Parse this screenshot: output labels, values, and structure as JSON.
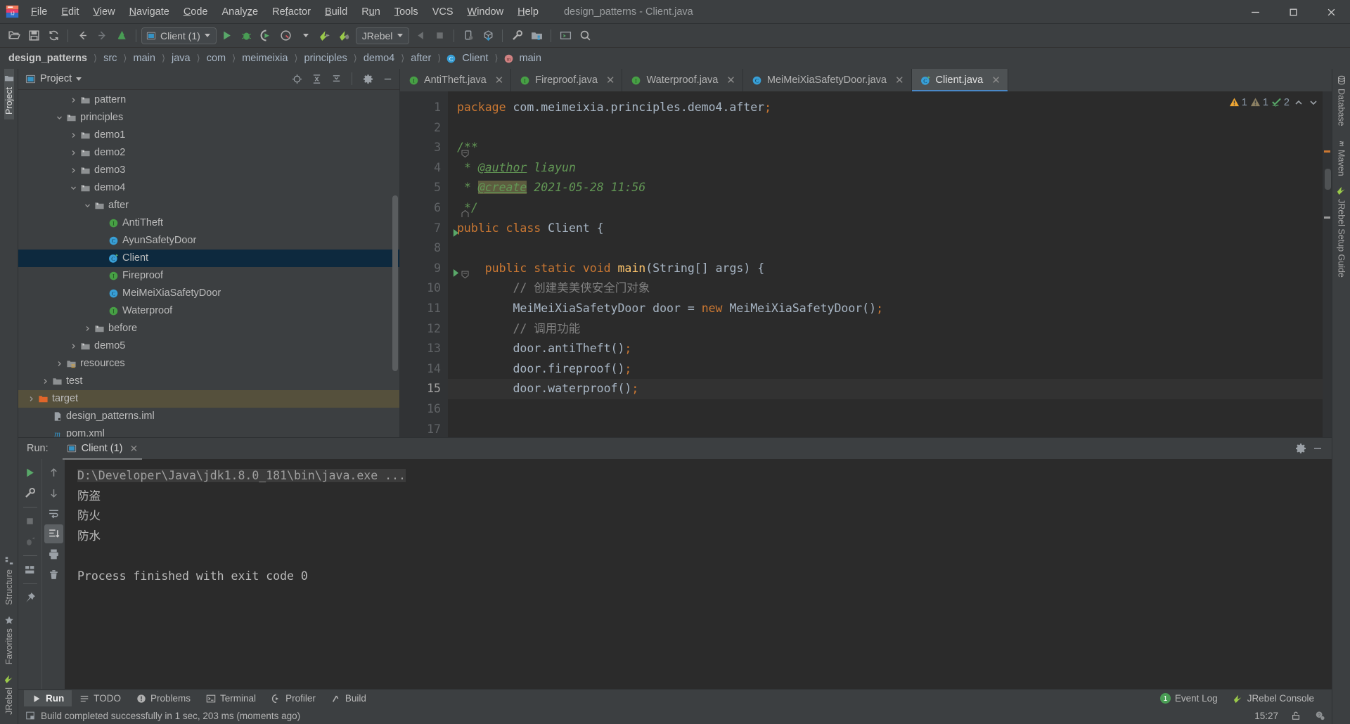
{
  "window": {
    "title": "design_patterns - Client.java",
    "minimize": "Minimize",
    "maximize": "Maximize",
    "close": "Close"
  },
  "menubar": [
    {
      "label": "File"
    },
    {
      "label": "Edit"
    },
    {
      "label": "View"
    },
    {
      "label": "Navigate"
    },
    {
      "label": "Code"
    },
    {
      "label": "Analyze"
    },
    {
      "label": "Refactor"
    },
    {
      "label": "Build"
    },
    {
      "label": "Run"
    },
    {
      "label": "Tools"
    },
    {
      "label": "VCS"
    },
    {
      "label": "Window"
    },
    {
      "label": "Help"
    }
  ],
  "toolbar": {
    "run_config": "Client (1)",
    "jrebel": "JRebel"
  },
  "breadcrumb": [
    {
      "label": "design_patterns",
      "icon": ""
    },
    {
      "label": "src",
      "icon": ""
    },
    {
      "label": "main",
      "icon": ""
    },
    {
      "label": "java",
      "icon": ""
    },
    {
      "label": "com",
      "icon": ""
    },
    {
      "label": "meimeixia",
      "icon": ""
    },
    {
      "label": "principles",
      "icon": ""
    },
    {
      "label": "demo4",
      "icon": ""
    },
    {
      "label": "after",
      "icon": ""
    },
    {
      "label": "Client",
      "icon": "class-icon"
    },
    {
      "label": "main",
      "icon": "method-icon"
    }
  ],
  "left_strip": [
    {
      "label": "Project",
      "icon": "project-icon",
      "active": true
    },
    {
      "label": "Structure",
      "icon": "structure-icon",
      "active": false
    },
    {
      "label": "Favorites",
      "icon": "star-icon",
      "active": false
    },
    {
      "label": "JRebel",
      "icon": "jrebel-icon",
      "active": false
    }
  ],
  "right_strip": [
    {
      "label": "Database",
      "icon": "database-icon"
    },
    {
      "label": "Maven",
      "icon": "maven-icon"
    },
    {
      "label": "JRebel Setup Guide",
      "icon": "jrebel-icon"
    }
  ],
  "project_panel": {
    "title": "Project",
    "tree": [
      {
        "label": "pattern",
        "indent": 4,
        "arrow": "right",
        "icon": "folder-java",
        "state": "normal"
      },
      {
        "label": "principles",
        "indent": 3,
        "arrow": "down",
        "icon": "folder-java",
        "state": "normal"
      },
      {
        "label": "demo1",
        "indent": 4,
        "arrow": "right",
        "icon": "folder-java",
        "state": "normal"
      },
      {
        "label": "demo2",
        "indent": 4,
        "arrow": "right",
        "icon": "folder-java",
        "state": "normal"
      },
      {
        "label": "demo3",
        "indent": 4,
        "arrow": "right",
        "icon": "folder-java",
        "state": "normal"
      },
      {
        "label": "demo4",
        "indent": 4,
        "arrow": "down",
        "icon": "folder-java",
        "state": "normal"
      },
      {
        "label": "after",
        "indent": 5,
        "arrow": "down",
        "icon": "folder-java",
        "state": "normal"
      },
      {
        "label": "AntiTheft",
        "indent": 6,
        "arrow": "none",
        "icon": "interface-icon",
        "state": "normal"
      },
      {
        "label": "AyunSafetyDoor",
        "indent": 6,
        "arrow": "none",
        "icon": "class-icon",
        "state": "normal"
      },
      {
        "label": "Client",
        "indent": 6,
        "arrow": "none",
        "icon": "class-run-icon",
        "state": "selected"
      },
      {
        "label": "Fireproof",
        "indent": 6,
        "arrow": "none",
        "icon": "interface-icon",
        "state": "normal"
      },
      {
        "label": "MeiMeiXiaSafetyDoor",
        "indent": 6,
        "arrow": "none",
        "icon": "class-icon",
        "state": "normal"
      },
      {
        "label": "Waterproof",
        "indent": 6,
        "arrow": "none",
        "icon": "interface-icon",
        "state": "normal"
      },
      {
        "label": "before",
        "indent": 5,
        "arrow": "right",
        "icon": "folder-java",
        "state": "normal"
      },
      {
        "label": "demo5",
        "indent": 4,
        "arrow": "right",
        "icon": "folder-java",
        "state": "normal"
      },
      {
        "label": "resources",
        "indent": 3,
        "arrow": "right",
        "icon": "folder-resources",
        "state": "normal"
      },
      {
        "label": "test",
        "indent": 2,
        "arrow": "right",
        "icon": "folder-plain",
        "state": "normal"
      },
      {
        "label": "target",
        "indent": 1,
        "arrow": "right",
        "icon": "folder-target",
        "state": "target"
      },
      {
        "label": "design_patterns.iml",
        "indent": 2,
        "arrow": "none",
        "icon": "iml-icon",
        "state": "normal"
      },
      {
        "label": "pom.xml",
        "indent": 2,
        "arrow": "none",
        "icon": "maven-icon",
        "state": "normal"
      }
    ]
  },
  "editor": {
    "tabs": [
      {
        "label": "AntiTheft.java",
        "icon": "interface-icon",
        "active": false
      },
      {
        "label": "Fireproof.java",
        "icon": "interface-icon",
        "active": false
      },
      {
        "label": "Waterproof.java",
        "icon": "interface-icon",
        "active": false
      },
      {
        "label": "MeiMeiXiaSafetyDoor.java",
        "icon": "class-icon",
        "active": false
      },
      {
        "label": "Client.java",
        "icon": "class-run-icon",
        "active": true
      }
    ],
    "inspection": {
      "warnings": "1",
      "weak_warnings": "1",
      "typos": "2"
    },
    "current_line": 15,
    "lines": [
      {
        "n": 1,
        "html": "<span class=\"kw\">package</span> com.meimeixia.principles.demo4.after<span class=\"sem\">;</span>"
      },
      {
        "n": 2,
        "html": ""
      },
      {
        "n": 3,
        "html": "<span class=\"jdoc\">/**</span>",
        "fold": "start"
      },
      {
        "n": 4,
        "html": " <span class=\"jdoc\">* </span><span class=\"jtag\">@author</span><span class=\"jdoc\"> liayun</span>"
      },
      {
        "n": 5,
        "html": " <span class=\"jdoc\">* </span><span class=\"jtag-hl\">@create</span><span class=\"jdoc\"> 2021-05-28 11:56</span>"
      },
      {
        "n": 6,
        "html": " <span class=\"jdoc\">*/</span>",
        "fold": "end"
      },
      {
        "n": 7,
        "html": "<span class=\"kw\">public class </span><span class=\"cls\">Client</span> {",
        "run": true
      },
      {
        "n": 8,
        "html": ""
      },
      {
        "n": 9,
        "html": "    <span class=\"kw\">public static void </span><span class=\"fn\">main</span>(String[] args) {",
        "run": true,
        "fold": "start"
      },
      {
        "n": 10,
        "html": "        <span class=\"cmt\">// 创建美美侠安全门对象</span>"
      },
      {
        "n": 11,
        "html": "        MeiMeiXiaSafetyDoor door = <span class=\"kw\">new </span>MeiMeiXiaSafetyDoor()<span class=\"sem\">;</span>"
      },
      {
        "n": 12,
        "html": "        <span class=\"cmt\">// 调用功能</span>"
      },
      {
        "n": 13,
        "html": "        door.antiTheft()<span class=\"sem\">;</span>"
      },
      {
        "n": 14,
        "html": "        door.fireproof()<span class=\"sem\">;</span>"
      },
      {
        "n": 15,
        "html": "        door.waterproof()<span class=\"sem\">;</span>"
      },
      {
        "n": 16,
        "html": ""
      },
      {
        "n": 17,
        "html": ""
      }
    ]
  },
  "run_panel": {
    "label": "Run:",
    "tab": "Client (1)",
    "console": [
      {
        "text": "D:\\Developer\\Java\\jdk1.8.0_181\\bin\\java.exe ...",
        "style": "cmd"
      },
      {
        "text": "防盗",
        "style": "out"
      },
      {
        "text": "防火",
        "style": "out"
      },
      {
        "text": "防水",
        "style": "out"
      },
      {
        "text": "",
        "style": "out"
      },
      {
        "text": "Process finished with exit code 0",
        "style": "out"
      }
    ]
  },
  "bottom_bar": {
    "items": [
      {
        "label": "Run",
        "icon": "run-icon",
        "active": true
      },
      {
        "label": "TODO",
        "icon": "todo-icon",
        "active": false
      },
      {
        "label": "Problems",
        "icon": "problems-icon",
        "active": false
      },
      {
        "label": "Terminal",
        "icon": "terminal-icon",
        "active": false
      },
      {
        "label": "Profiler",
        "icon": "profiler-icon",
        "active": false
      },
      {
        "label": "Build",
        "icon": "build-icon",
        "active": false
      }
    ],
    "right": [
      {
        "label": "Event Log",
        "icon": "event-log-icon",
        "badge": "1"
      },
      {
        "label": "JRebel Console",
        "icon": "jrebel-icon",
        "badge": ""
      }
    ]
  },
  "status_bar": {
    "message": "Build completed successfully in 1 sec, 203 ms (moments ago)",
    "time": "15:27"
  },
  "colors": {
    "accent": "#4a88c7",
    "selection": "#0d293e",
    "target_highlight": "#55503c",
    "keyword": "#cc7832",
    "comment": "#808080",
    "javadoc": "#629755",
    "method": "#ffc66d",
    "green_run": "#59a869",
    "interface_green": "#47a045",
    "class_blue": "#389fd6"
  }
}
